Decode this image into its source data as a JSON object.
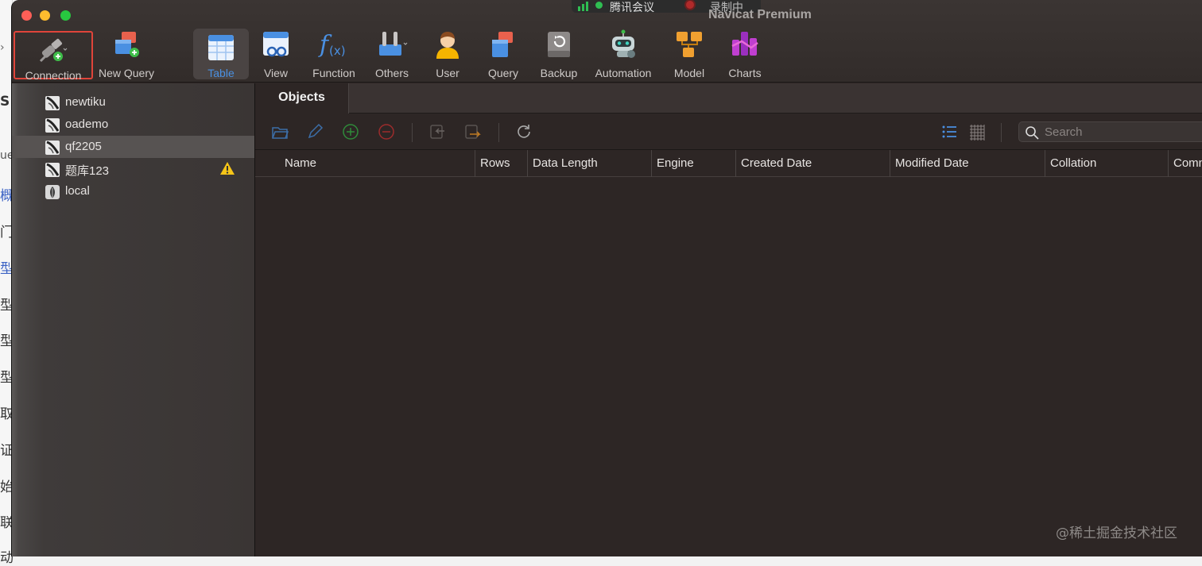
{
  "background_glyphs": [
    "S",
    "ue",
    "概",
    "门",
    "型",
    "型",
    "型",
    "型",
    "取",
    "证",
    "始",
    "联",
    "动"
  ],
  "window": {
    "title": "Navicat Premium",
    "traffic_lights": {
      "close": "#fe5f57",
      "minimize": "#febc2e",
      "zoom": "#28c840"
    }
  },
  "screen_overlay": {
    "meeting_label": "腾讯会议",
    "recording_label": "录制中"
  },
  "toolbar": {
    "items": [
      {
        "id": "connection",
        "label": "Connection",
        "icon": "plug-add-icon",
        "highlighted": true
      },
      {
        "id": "new-query",
        "label": "New Query",
        "icon": "new-query-icon"
      },
      {
        "id": "table",
        "label": "Table",
        "icon": "table-icon",
        "active": true
      },
      {
        "id": "view",
        "label": "View",
        "icon": "view-icon"
      },
      {
        "id": "function",
        "label": "Function",
        "icon": "function-icon"
      },
      {
        "id": "others",
        "label": "Others",
        "icon": "tools-icon"
      },
      {
        "id": "user",
        "label": "User",
        "icon": "user-icon"
      },
      {
        "id": "query",
        "label": "Query",
        "icon": "query-icon"
      },
      {
        "id": "backup",
        "label": "Backup",
        "icon": "backup-icon"
      },
      {
        "id": "automation",
        "label": "Automation",
        "icon": "robot-icon"
      },
      {
        "id": "model",
        "label": "Model",
        "icon": "model-icon"
      },
      {
        "id": "charts",
        "label": "Charts",
        "icon": "charts-icon"
      }
    ]
  },
  "sidebar": {
    "connections": [
      {
        "name": "newtiku",
        "icon": "mysql-connection-icon"
      },
      {
        "name": "oademo",
        "icon": "mysql-connection-icon"
      },
      {
        "name": "qf2205",
        "icon": "mysql-connection-icon",
        "selected": true
      },
      {
        "name": "题库123",
        "icon": "mysql-connection-icon",
        "warning": true
      },
      {
        "name": "local",
        "icon": "mongodb-connection-icon"
      }
    ]
  },
  "main": {
    "tab_label": "Objects",
    "search_placeholder": "Search",
    "columns": [
      "Name",
      "Rows",
      "Data Length",
      "Engine",
      "Created Date",
      "Modified Date",
      "Collation",
      "Comm"
    ]
  },
  "watermark": "@稀土掘金技术社区",
  "colors": {
    "accent": "#4a90e2",
    "highlight_border": "#e0443a",
    "window_bg": "#2d2625"
  }
}
